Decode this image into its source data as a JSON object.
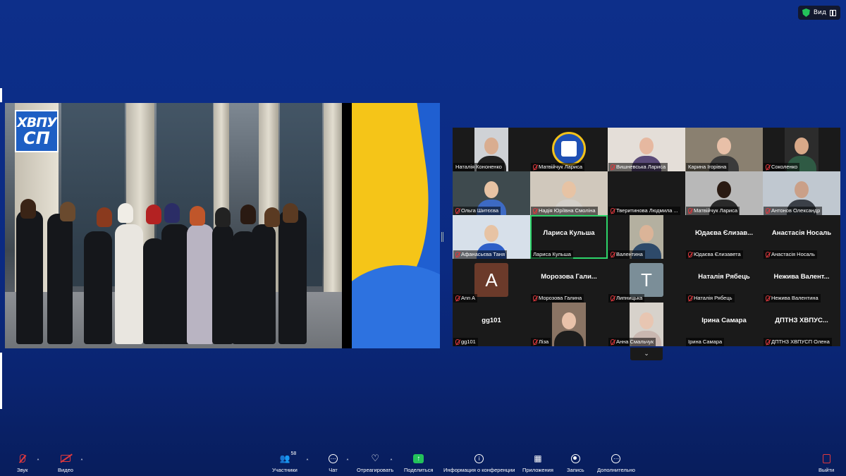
{
  "header": {
    "view_label": "Вид",
    "view_icon": "grid-icon",
    "security_icon": "shield-icon",
    "security_color": "#23c25a"
  },
  "shared_screen": {
    "logo_line1": "ХВПУ",
    "logo_line2": "СП"
  },
  "gallery": {
    "participants": [
      {
        "name": "Наталія Кононенко",
        "muted": false,
        "display": "video"
      },
      {
        "name": "Матвійчук Лариса",
        "muted": true,
        "display": "logo"
      },
      {
        "name": "Вишневська Лариса",
        "muted": true,
        "display": "video"
      },
      {
        "name": "Карина Ігорівна",
        "muted": false,
        "display": "video"
      },
      {
        "name": "Соколенко",
        "muted": true,
        "display": "video"
      },
      {
        "name": "Ольга Шитєєва",
        "muted": true,
        "display": "video"
      },
      {
        "name": "Надія Юріївна Смоліна",
        "muted": true,
        "display": "video"
      },
      {
        "name": "Тверитинова Людмила ...",
        "muted": true,
        "display": "blank"
      },
      {
        "name": "Матвійчук Лариса",
        "muted": true,
        "display": "video"
      },
      {
        "name": "Антонов Олександр",
        "muted": true,
        "display": "video"
      },
      {
        "name": "Афанасьєва Таня",
        "muted": true,
        "display": "video"
      },
      {
        "name": "Лариса Кульша",
        "muted": false,
        "display": "name",
        "big_name": "Лариса Кульша",
        "active": true
      },
      {
        "name": "Валентина",
        "muted": true,
        "display": "video"
      },
      {
        "name": "Юдаєва Єлизавета",
        "muted": true,
        "display": "name",
        "big_name": "Юдаєва Єлизав..."
      },
      {
        "name": "Анастасія Носаль",
        "muted": true,
        "display": "name",
        "big_name": "Анастасія Носаль"
      },
      {
        "name": "Ann A",
        "muted": true,
        "display": "letter",
        "letter": "A",
        "letter_bg": "#6b3a2a"
      },
      {
        "name": "Морозова Галина",
        "muted": true,
        "display": "name",
        "big_name": "Морозова Гали..."
      },
      {
        "name": "Липницька",
        "muted": true,
        "display": "letter",
        "letter": "T",
        "letter_bg": "#7b8e98"
      },
      {
        "name": "Наталія Рябець",
        "muted": true,
        "display": "name",
        "big_name": "Наталія Рябець"
      },
      {
        "name": "Нежива Валентина",
        "muted": true,
        "display": "name",
        "big_name": "Нежива Валент..."
      },
      {
        "name": "gg101",
        "muted": true,
        "display": "name",
        "big_name": "gg101"
      },
      {
        "name": "Ліза",
        "muted": true,
        "display": "video"
      },
      {
        "name": "Анна Смальчук",
        "muted": true,
        "display": "video"
      },
      {
        "name": "Ірина Самара",
        "muted": false,
        "display": "name",
        "big_name": "Ірина Самара"
      },
      {
        "name": "ДПТНЗ ХВПУСП Олена",
        "muted": true,
        "display": "name",
        "big_name": "ДПТНЗ  ХВПУС..."
      }
    ],
    "more_icon": "chevron-down-icon"
  },
  "toolbar": {
    "audio": {
      "label": "Звук",
      "icon": "mic-muted-icon"
    },
    "video": {
      "label": "Видео",
      "icon": "camera-off-icon"
    },
    "participants": {
      "label": "Участники",
      "count": "58",
      "icon": "people-icon"
    },
    "chat": {
      "label": "Чат",
      "icon": "chat-icon"
    },
    "react": {
      "label": "Отреагировать",
      "icon": "heart-icon"
    },
    "share": {
      "label": "Поделиться",
      "icon": "share-icon"
    },
    "info": {
      "label": "Информация о конференции",
      "icon": "info-icon"
    },
    "apps": {
      "label": "Приложения",
      "icon": "apps-icon"
    },
    "record": {
      "label": "Запись",
      "icon": "record-icon"
    },
    "more": {
      "label": "Дополнительно",
      "icon": "more-icon"
    },
    "leave": {
      "label": "Выйти",
      "icon": "exit-icon"
    },
    "accent_red": "#e0393e",
    "accent_green": "#23c25a"
  }
}
